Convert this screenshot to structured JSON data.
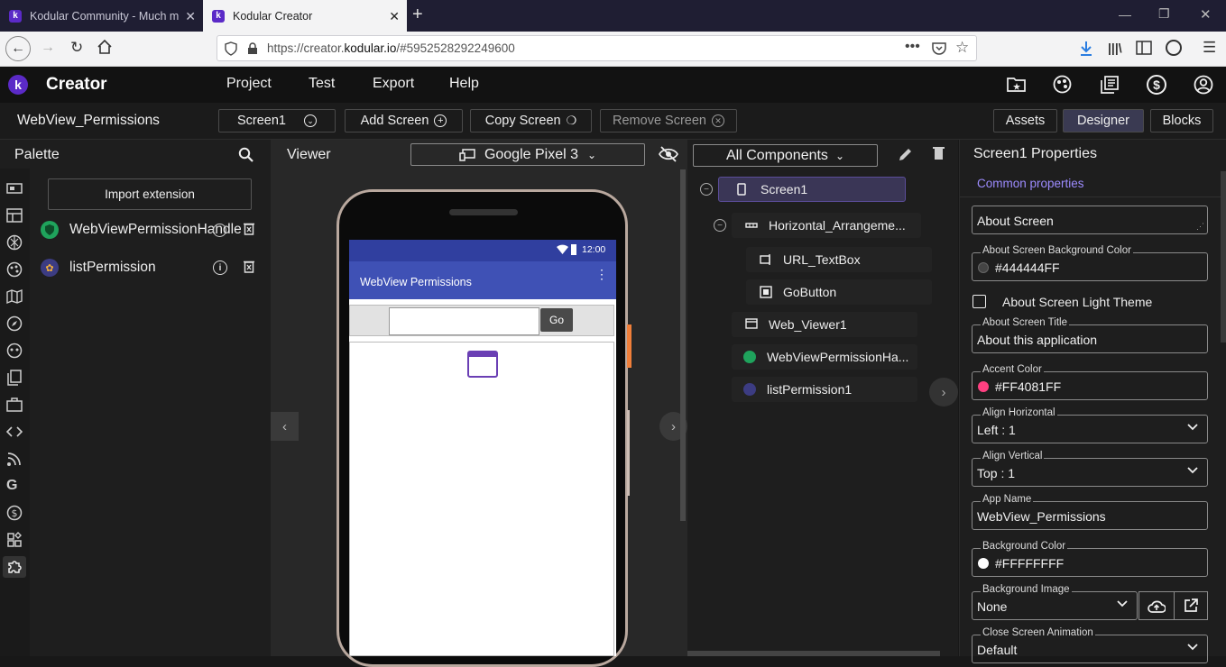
{
  "browser": {
    "tabs": [
      {
        "title": "Kodular Community - Much m",
        "active": false
      },
      {
        "title": "Kodular Creator",
        "active": true
      }
    ],
    "url_prefix": "https://creator.",
    "url_domain": "kodular.io",
    "url_suffix": "/#5952528292249600"
  },
  "app": {
    "logo_letter": "k",
    "brand": "Creator",
    "menu": [
      "Project",
      "Test",
      "Export",
      "Help"
    ]
  },
  "toolbar": {
    "project_name": "WebView_Permissions",
    "screen_select": "Screen1",
    "add_screen": "Add Screen",
    "copy_screen": "Copy Screen",
    "remove_screen": "Remove Screen",
    "assets": "Assets",
    "designer": "Designer",
    "blocks": "Blocks"
  },
  "palette": {
    "title": "Palette",
    "import_button": "Import extension",
    "items": [
      {
        "label": "WebViewPermissionHandler"
      },
      {
        "label": "listPermission"
      }
    ]
  },
  "viewer": {
    "title": "Viewer",
    "device": "Google Pixel 3",
    "phone": {
      "time": "12:00",
      "app_title": "WebView Permissions",
      "go_button": "Go"
    }
  },
  "tree": {
    "filter": "All Components",
    "nodes": [
      {
        "label": "Screen1"
      },
      {
        "label": "Horizontal_Arrangeme..."
      },
      {
        "label": "URL_TextBox"
      },
      {
        "label": "GoButton"
      },
      {
        "label": "Web_Viewer1"
      },
      {
        "label": "WebViewPermissionHa..."
      },
      {
        "label": "listPermission1"
      }
    ]
  },
  "properties": {
    "title": "Screen1 Properties",
    "section": "Common properties",
    "about_screen": "About Screen",
    "bg_color_label": "About Screen Background Color",
    "bg_color_value": "#444444FF",
    "light_theme_label": "About Screen Light Theme",
    "about_title_label": "About Screen Title",
    "about_title_value": "About this application",
    "accent_label": "Accent Color",
    "accent_value": "#FF4081FF",
    "align_h_label": "Align Horizontal",
    "align_h_value": "Left : 1",
    "align_v_label": "Align Vertical",
    "align_v_value": "Top : 1",
    "app_name_label": "App Name",
    "app_name_value": "WebView_Permissions",
    "background_color_label": "Background Color",
    "background_color_value": "#FFFFFFFF",
    "background_image_label": "Background Image",
    "background_image_value": "None",
    "close_anim_label": "Close Screen Animation",
    "close_anim_value": "Default"
  },
  "colors": {
    "brand_purple": "#5b2ac7",
    "app_bar_blue": "#3f51b5",
    "accent_pink": "#ff4081",
    "bg_dark_gray": "#444444",
    "link_purple": "#9d8cff"
  }
}
